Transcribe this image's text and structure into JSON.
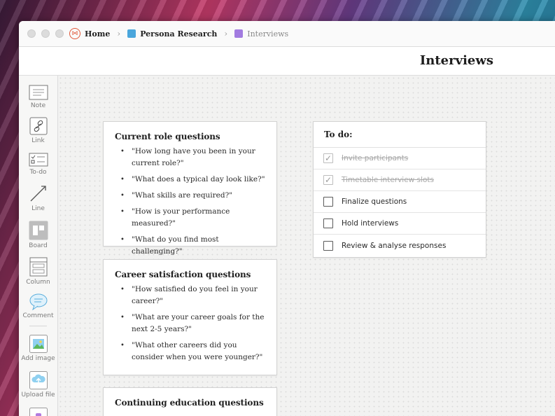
{
  "breadcrumbs": [
    {
      "label": "Home",
      "icon": "home-icon",
      "color": "#e0583a"
    },
    {
      "label": "Persona Research",
      "icon": "board-square-icon",
      "color": "#4aa6dc"
    },
    {
      "label": "Interviews",
      "icon": "board-square-icon",
      "color": "#a27be0"
    }
  ],
  "page": {
    "title": "Interviews"
  },
  "toolbar": {
    "items": [
      {
        "label": "Note",
        "icon": "note-icon"
      },
      {
        "label": "Link",
        "icon": "link-icon"
      },
      {
        "label": "To-do",
        "icon": "todo-icon"
      },
      {
        "label": "Line",
        "icon": "line-icon"
      },
      {
        "label": "Board",
        "icon": "board-icon"
      },
      {
        "label": "Column",
        "icon": "column-icon"
      },
      {
        "label": "Comment",
        "icon": "comment-icon"
      },
      {
        "label": "Add image",
        "icon": "image-icon"
      },
      {
        "label": "Upload file",
        "icon": "upload-icon"
      }
    ]
  },
  "cards": [
    {
      "title": "Current role questions",
      "items": [
        "\"How long have you been in your current role?\"",
        "\"What does a typical day look like?\"",
        "\"What skills are required?\"",
        "\"How is your performance measured?\"",
        "\"What do you find most challenging?\""
      ]
    },
    {
      "title": "Career satisfaction questions",
      "items": [
        "\"How satisfied do you feel in your career?\"",
        "\"What are your career goals for the next 2-5 years?\"",
        "\"What other careers did you consider when you were younger?\""
      ]
    },
    {
      "title": "Continuing education questions",
      "items": []
    }
  ],
  "todo": {
    "title": "To do:",
    "items": [
      {
        "text": "Invite participants",
        "done": true
      },
      {
        "text": "Timetable interview slots",
        "done": true
      },
      {
        "text": "Finalize questions",
        "done": false
      },
      {
        "text": "Hold interviews",
        "done": false
      },
      {
        "text": "Review & analyse responses",
        "done": false
      }
    ]
  }
}
